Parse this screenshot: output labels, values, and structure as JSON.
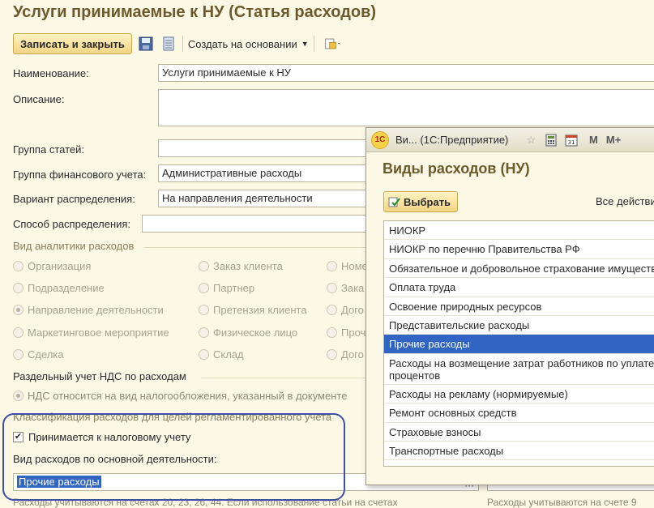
{
  "window": {
    "title": "Услуги принимаемые к НУ (Статья расходов)"
  },
  "toolbar": {
    "save_close": "Записать и закрыть",
    "create_based": "Создать на основании"
  },
  "form": {
    "name_label": "Наименование:",
    "name_value": "Услуги принимаемые к НУ",
    "description_label": "Описание:",
    "group_label": "Группа статей:",
    "fin_group_label": "Группа финансового учета:",
    "fin_group_value": "Административные расходы",
    "distribution_variant_label": "Вариант распределения:",
    "distribution_variant_value": "На направления деятельности",
    "distribution_method_label": "Способ распределения:"
  },
  "analytics": {
    "title": "Вид аналитики расходов",
    "options": [
      "Организация",
      "Подразделение",
      "Направление деятельности",
      "Маркетинговое мероприятие",
      "Сделка",
      "Заказ клиента",
      "Партнер",
      "Претензия клиента",
      "Физическое лицо",
      "Склад",
      "Номе",
      "Зака",
      "Дого",
      "Проч",
      "Дого"
    ]
  },
  "vat": {
    "title": "Раздельный учет НДС по расходам",
    "option": "НДС относится на вид налогообложения, указанный в документе"
  },
  "classification": {
    "title": "Классификация расходов для целей регламентированного учета",
    "accepted_label": "Принимается к налоговому учету",
    "main_activity_label": "Вид расходов по основной деятельности:",
    "main_activity_value": "Прочие расходы",
    "bottom_left": "Расходы учитываются на счетах 20, 23, 26, 44. Если использование статьи на счетах",
    "bottom_right": "Расходы учитываются на счете 9"
  },
  "popup": {
    "titlebar": "Ви...  (1С:Предприятие)",
    "logo": "1С",
    "heading": "Виды расходов (НУ)",
    "choose_button": "Выбрать",
    "all_actions": "Все действия",
    "m_label": "M",
    "mplus_label": "M+",
    "items": [
      "НИОКР",
      "НИОКР по перечню Правительства РФ",
      "Обязательное и добровольное страхование имущества",
      "Оплата труда",
      "Освоение природных ресурсов",
      "Представительские расходы",
      "Прочие расходы",
      "Расходы на возмещение затрат работников по уплате процентов",
      "Расходы на рекламу (нормируемые)",
      "Ремонт основных средств",
      "Страховые взносы",
      "Транспортные расходы"
    ]
  },
  "colors": {
    "accent_title": "#6d5a2c",
    "selection": "#3065c4",
    "annotation": "#3d4fa6"
  }
}
